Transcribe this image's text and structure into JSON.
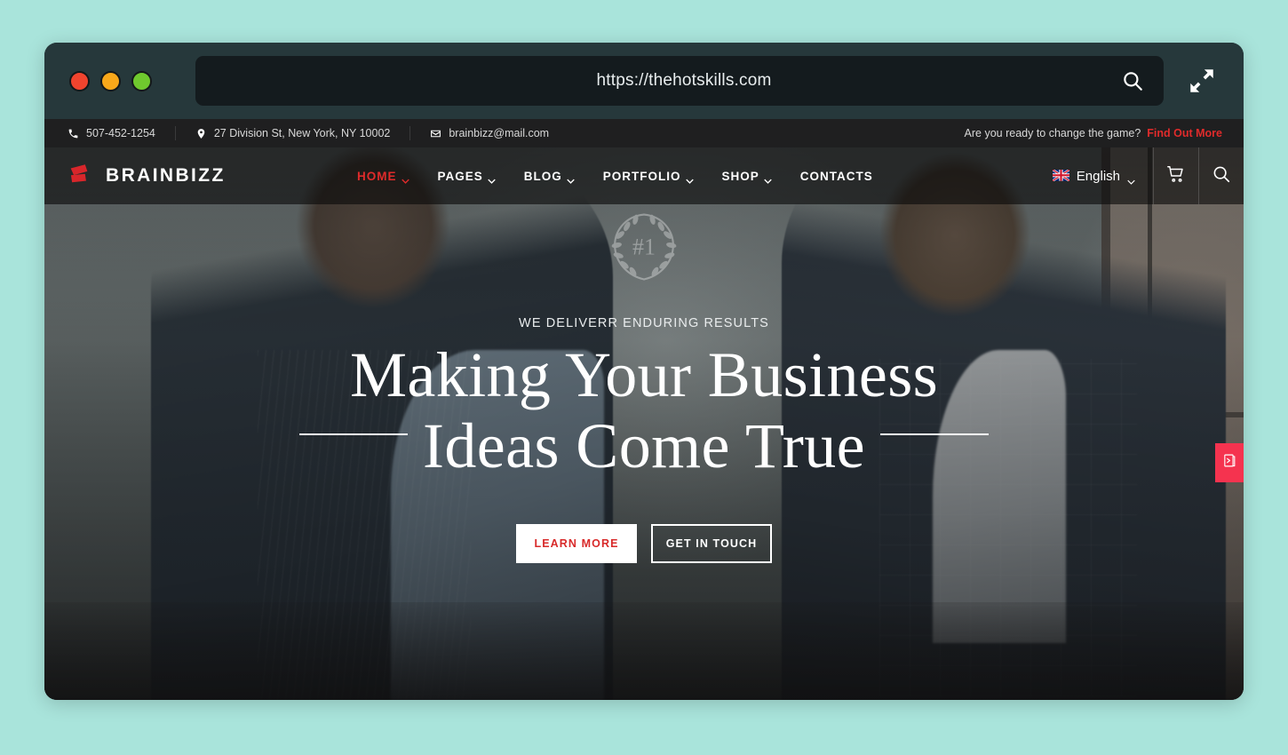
{
  "browser": {
    "url": "https://thehotskills.com",
    "search_icon": "search-icon",
    "expand_icon": "expand-arrows-icon",
    "traffic_lights": [
      "close-red",
      "minimize-yellow",
      "maximize-green"
    ]
  },
  "topbar": {
    "phone": "507-452-1254",
    "address": "27 Division St, New York, NY 10002",
    "email": "brainbizz@mail.com",
    "promo_text": "Are you ready to change the game?",
    "promo_cta": "Find Out More",
    "icons": {
      "phone": "phone-icon",
      "location": "location-pin-icon",
      "email": "envelope-icon"
    }
  },
  "nav": {
    "brand": "BRAINBIZZ",
    "brand_mark": "brainbizz-logo-icon",
    "items": [
      {
        "label": "HOME",
        "has_caret": true,
        "active": true
      },
      {
        "label": "PAGES",
        "has_caret": true,
        "active": false
      },
      {
        "label": "BLOG",
        "has_caret": true,
        "active": false
      },
      {
        "label": "PORTFOLIO",
        "has_caret": true,
        "active": false
      },
      {
        "label": "SHOP",
        "has_caret": true,
        "active": false
      },
      {
        "label": "CONTACTS",
        "has_caret": false,
        "active": false
      }
    ],
    "language": "English",
    "language_flag": "uk-flag-icon",
    "cart_icon": "shopping-cart-icon",
    "search_icon": "search-icon"
  },
  "hero": {
    "badge_text": "#1",
    "badge_icon": "laurel-wreath-badge-icon",
    "eyebrow": "WE DELIVERR ENDURING RESULTS",
    "headline_line1": "Making Your Business",
    "headline_line2": "Ideas Come True",
    "button_primary": "LEARN MORE",
    "button_secondary": "GET IN TOUCH"
  },
  "side_tab": {
    "icon": "book-purchase-icon"
  },
  "colors": {
    "page_background": "#a9e4db",
    "browser_chrome": "#26383b",
    "url_bar": "#141b1e",
    "accent_red": "#e02b2b",
    "button_red": "#d82a2a",
    "side_tab_pink": "#f5334f",
    "topbar_background": "#1f1f20"
  }
}
